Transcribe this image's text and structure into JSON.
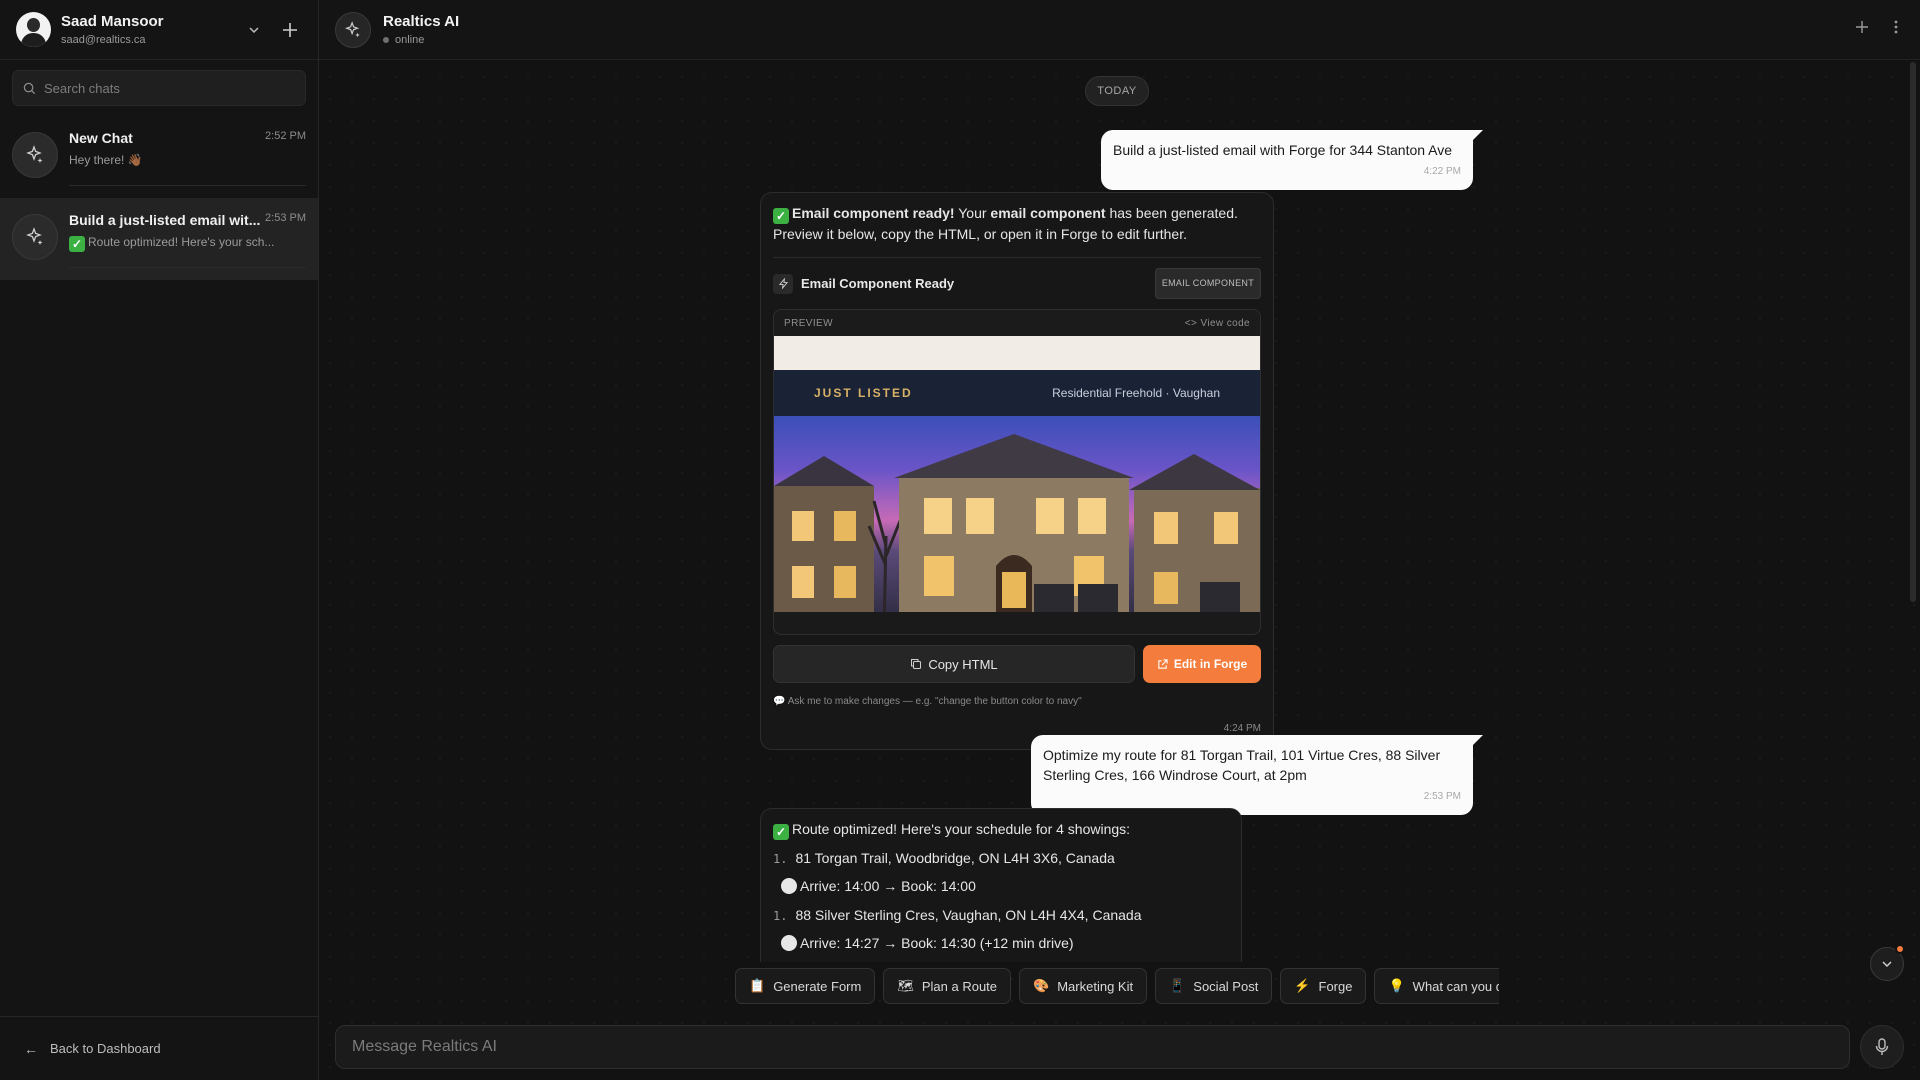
{
  "sidebar": {
    "user_name": "Saad Mansoor",
    "user_email": "saad@realtics.ca",
    "search_placeholder": "Search chats",
    "chats": [
      {
        "title": "New Chat",
        "time": "2:52 PM",
        "preview": "Hey there! 👋🏾"
      },
      {
        "title": "Build a just-listed email wit...",
        "time": "2:53 PM",
        "preview": "Route optimized! Here's your sch..."
      }
    ],
    "back_label": "Back to Dashboard"
  },
  "header": {
    "bot_name": "Realtics AI",
    "status": "online"
  },
  "thread": {
    "day_label": "TODAY",
    "msg1": {
      "text": "Build a just-listed email with Forge for 344 Stanton Ave",
      "time": "4:22 PM"
    },
    "msg2": {
      "bold1": "Email component ready!",
      "t1": " Your ",
      "bold2": "email component",
      "t2": " has been generated. Preview it below, copy the HTML, or open it in Forge to edit further.",
      "comp_title": "Email Component Ready",
      "comp_badge": "EMAIL COMPONENT",
      "preview_label": "PREVIEW",
      "view_code": "View code",
      "email_headline": "JUST LISTED",
      "email_sub": "Residential Freehold · Vaughan",
      "copy_label": "Copy HTML",
      "forge_label": "Edit in Forge",
      "hint": "Ask me to make changes — e.g. \"change the button color to navy\"",
      "time": "4:24 PM"
    },
    "msg3": {
      "text": "Optimize my route for 81 Torgan Trail, 101 Virtue Cres, 88 Silver Sterling Cres, 166 Windrose Court, at 2pm",
      "time": "2:53 PM"
    },
    "msg4": {
      "intro": "Route optimized! Here's your schedule for 4 showings:",
      "stops": [
        {
          "num": "1.",
          "address": "81 Torgan Trail, Woodbridge, ON L4H 3X6, Canada",
          "detail": "Arrive: 14:00 → Book: 14:00"
        },
        {
          "num": "1.",
          "address": "88 Silver Sterling Cres, Vaughan, ON L4H 4X4, Canada",
          "detail": "Arrive: 14:27 → Book: 14:30 (+12 min drive)"
        }
      ]
    }
  },
  "chips": [
    {
      "icon": "📋",
      "label": "Generate Form"
    },
    {
      "icon": "🗺",
      "label": "Plan a Route"
    },
    {
      "icon": "🎨",
      "label": "Marketing Kit"
    },
    {
      "icon": "📱",
      "label": "Social Post"
    },
    {
      "icon": "⚡",
      "label": "Forge"
    },
    {
      "icon": "💡",
      "label": "What can you do?"
    }
  ],
  "composer": {
    "placeholder": "Message Realtics AI"
  },
  "colors": {
    "accent": "#f47c3c",
    "check": "#3cb043",
    "email_band": "#1a2236",
    "email_gold": "#d9b166"
  }
}
